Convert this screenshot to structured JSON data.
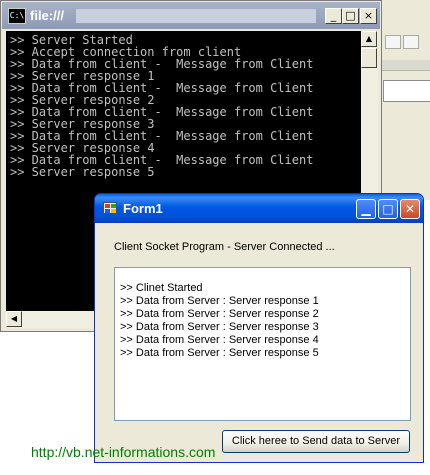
{
  "background_app": {},
  "console": {
    "title": "file:///",
    "buttons": {
      "minimize": "_",
      "maximize": "□",
      "close": "×"
    },
    "lines": [
      ">> Server Started",
      ">> Accept connection from client",
      ">> Data from client -  Message from Client",
      ">> Server response 1",
      ">> Data from client -  Message from Client",
      ">> Server response 2",
      ">> Data from client -  Message from Client",
      ">> Server response 3",
      ">> Data from client -  Message from Client",
      ">> Server response 4",
      ">> Data from client -  Message from Client",
      ">> Server response 5"
    ]
  },
  "form": {
    "title": "Form1",
    "status": "Client Socket Program - Server Connected ...",
    "lines": [
      ">> Clinet Started",
      ">> Data from Server : Server response 1",
      ">> Data from Server : Server response 2",
      ">> Data from Server : Server response 3",
      ">> Data from Server : Server response 4",
      ">> Data from Server : Server response 5"
    ],
    "send_button": "Click heree to Send data to Server"
  },
  "footer": {
    "url": "http://vb.net-informations.com"
  },
  "colors": {
    "console_bg": "#000000",
    "console_text": "#c0c0c0",
    "xp_blue": "#0058e6",
    "footer_green": "#008000"
  }
}
